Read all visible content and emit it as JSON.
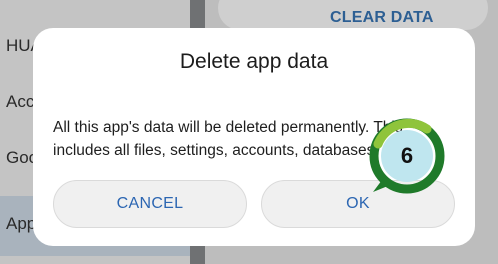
{
  "background": {
    "list_items": [
      "HUA",
      "Acc",
      "Goo",
      "App"
    ],
    "clear_data_label": "CLEAR DATA"
  },
  "dialog": {
    "title": "Delete app data",
    "message_line1": "All this app's data will be deleted permanently. This",
    "message_line2": "includes all files, settings, accounts, databases, e",
    "cancel_label": "CANCEL",
    "ok_label": "OK"
  },
  "step_badge": {
    "number": "6",
    "colors": {
      "ring": "#1f7a2a",
      "accent": "#8fc43b",
      "fill": "#bfe6ef"
    }
  }
}
